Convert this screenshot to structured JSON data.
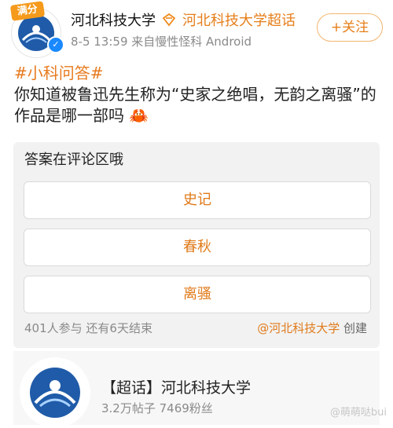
{
  "header": {
    "logo_text": "满分",
    "username": "河北科技大学",
    "super_topic_name": "河北科技大学超话",
    "meta": "8-5 13:59  来自慢性怪科 Android",
    "follow_label": "+关注"
  },
  "post": {
    "hashtag": "#小科问答#",
    "text": "你知道被鲁迅先生称为“史家之绝唱，无韵之离骚”的作品是哪一部吗",
    "emoji": "🦀"
  },
  "poll": {
    "title": "答案在评论区哦",
    "options": [
      "史记",
      "春秋",
      "离骚"
    ],
    "footer": "401人参与  还有6天结束",
    "creator_at": "@河北科技大学",
    "creator_suffix": " 创建"
  },
  "topic_card": {
    "title": "【超话】河北科技大学",
    "stats": "3.2万帖子 7469粉丝"
  },
  "watermark": "@萌萌哒bui",
  "colors": {
    "accent": "#e67e1a",
    "verified_blue": "#1a89ff"
  }
}
